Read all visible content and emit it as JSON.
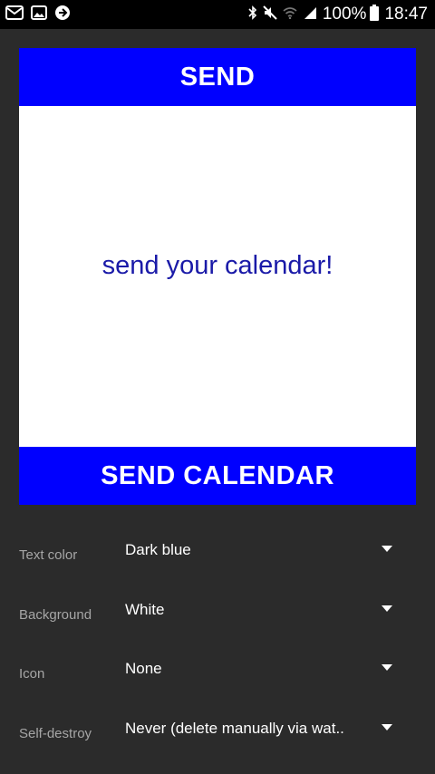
{
  "status_bar": {
    "left_icons": [
      "gmail-icon",
      "gallery-icon",
      "sync-icon"
    ],
    "right_icons": [
      "bluetooth-icon",
      "mute-icon",
      "wifi-icon",
      "signal-icon"
    ],
    "battery": "100%",
    "time": "18:47"
  },
  "preview": {
    "top_label": "SEND",
    "message": "send your calendar!",
    "bottom_label": "SEND CALENDAR",
    "colors": {
      "bar": "#0000ff",
      "text": "#1a1aa8",
      "background": "#ffffff"
    }
  },
  "settings": [
    {
      "label": "Text color",
      "value": "Dark blue"
    },
    {
      "label": "Background",
      "value": "White"
    },
    {
      "label": "Icon",
      "value": "None"
    },
    {
      "label": "Self-destroy",
      "value": "Never (delete manually via wat.."
    }
  ]
}
